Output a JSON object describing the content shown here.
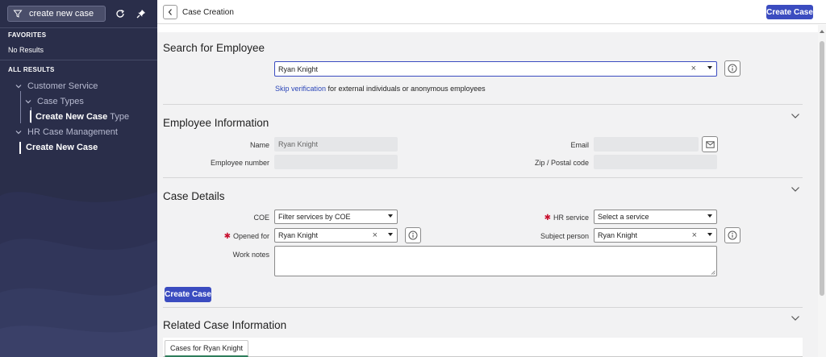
{
  "sidebar": {
    "filter_value": "create new case",
    "favorites_heading": "FAVORITES",
    "favorites_empty": "No Results",
    "all_results_heading": "ALL RESULTS",
    "items": [
      {
        "label": "Customer Service"
      },
      {
        "label": "Case Types"
      },
      {
        "label": "Create New Case",
        "suffix": "Type"
      },
      {
        "label": "HR Case Management"
      },
      {
        "label": "Create New Case"
      }
    ],
    "icons": [
      "filter-icon",
      "refresh-icon",
      "pin-icon"
    ]
  },
  "header": {
    "title": "Case Creation",
    "create_button": "Create Case"
  },
  "search": {
    "title": "Search for Employee",
    "value": "Ryan Knight",
    "skip_link": "Skip verification",
    "skip_suffix": " for external individuals or anonymous employees"
  },
  "employee": {
    "title": "Employee Information",
    "name_label": "Name",
    "name_value": "Ryan Knight",
    "number_label": "Employee number",
    "number_value": "",
    "email_label": "Email",
    "email_value": "",
    "zip_label": "Zip / Postal code",
    "zip_value": ""
  },
  "case_details": {
    "title": "Case Details",
    "coe_label": "COE",
    "coe_value": "Filter services by COE",
    "hr_service_label": "HR service",
    "hr_service_value": "Select a service",
    "opened_for_label": "Opened for",
    "opened_for_value": "Ryan Knight",
    "subject_label": "Subject person",
    "subject_value": "Ryan Knight",
    "work_notes_label": "Work notes",
    "work_notes_value": "",
    "required_mark": "✱",
    "create_button": "Create Case"
  },
  "related": {
    "title": "Related Case Information",
    "tab_label": "Cases for Ryan Knight"
  },
  "colors": {
    "sidebar_bg": "#2a2e4a",
    "primary": "#3b4cc0",
    "required": "#c8102e",
    "tab_accent": "#2e7d5b"
  }
}
